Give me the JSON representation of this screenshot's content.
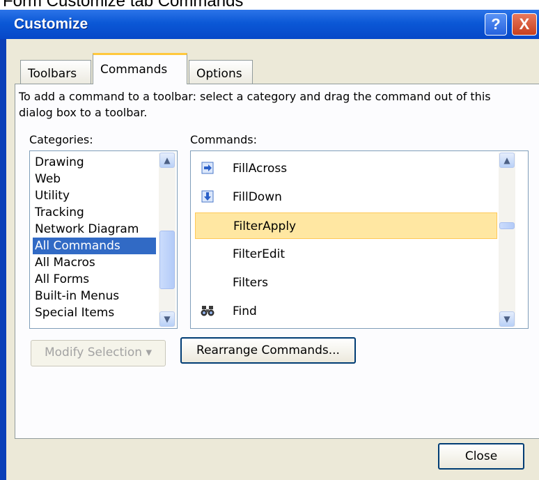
{
  "caption": "Form Customize tab Commands",
  "window": {
    "title": "Customize",
    "help_label": "?",
    "close_label": "X"
  },
  "tabs": [
    {
      "label": "Toolbars",
      "active": false
    },
    {
      "label": "Commands",
      "active": true
    },
    {
      "label": "Options",
      "active": false
    }
  ],
  "instructions": "To add a command to a toolbar: select a category and drag the command out of this dialog box to a toolbar.",
  "categories": {
    "label": "Categories:",
    "items": [
      "Drawing",
      "Web",
      "Utility",
      "Tracking",
      "Network Diagram",
      "All Commands",
      "All Macros",
      "All Forms",
      "Built-in Menus",
      "Special Items"
    ],
    "selected": "All Commands"
  },
  "commands": {
    "label": "Commands:",
    "items": [
      {
        "label": "FillAcross",
        "icon": "arrow-right-icon"
      },
      {
        "label": "FillDown",
        "icon": "arrow-down-icon"
      },
      {
        "label": "FilterApply",
        "icon": ""
      },
      {
        "label": "FilterEdit",
        "icon": ""
      },
      {
        "label": "Filters",
        "icon": ""
      },
      {
        "label": "Find",
        "icon": "binoculars-icon"
      }
    ],
    "selected": "FilterApply"
  },
  "buttons": {
    "modify_selection": "Modify Selection ▾",
    "rearrange_commands": "Rearrange Commands...",
    "close": "Close"
  },
  "colors": {
    "titlebar": "#0b58d6",
    "selection_blue": "#316ac5",
    "selection_highlight": "#ffe7a2",
    "dialog_face": "#ece9d8"
  }
}
